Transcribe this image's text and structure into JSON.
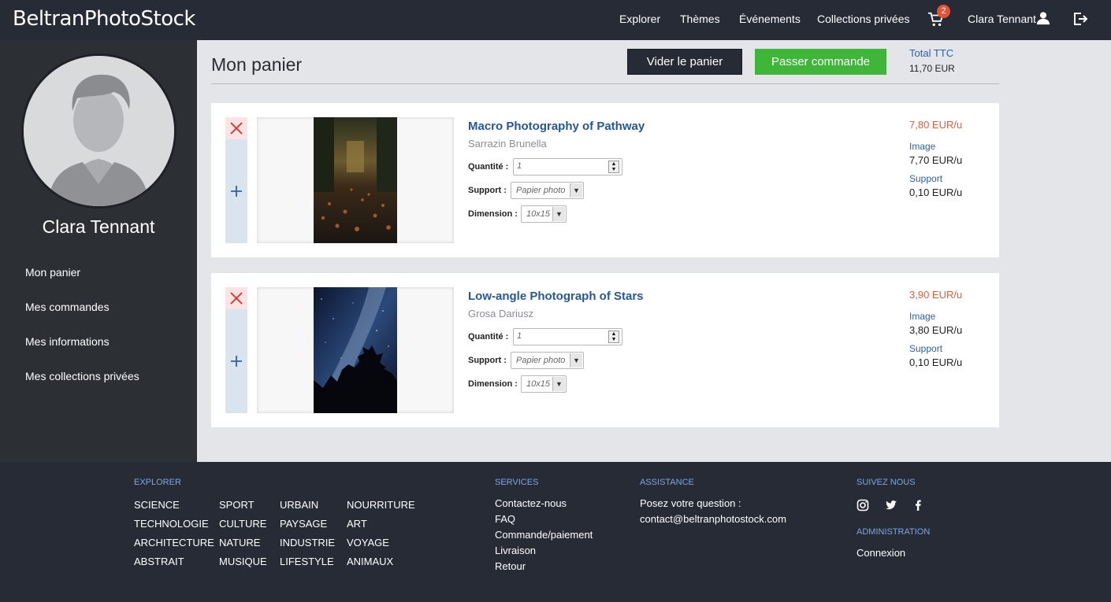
{
  "header": {
    "logo": "BeltranPhotoStock",
    "nav": [
      "Explorer",
      "Thèmes",
      "Événements",
      "Collections privées"
    ],
    "cart_count": "2",
    "user_name": "Clara Tennant"
  },
  "sidebar": {
    "name": "Clara Tennant",
    "links": [
      "Mon panier",
      "Mes commandes",
      "Mes informations",
      "Mes collections privées"
    ]
  },
  "main": {
    "title": "Mon panier",
    "clear_label": "Vider le panier",
    "checkout_label": "Passer commande",
    "total_label": "Total TTC",
    "total_value": "11,70 EUR",
    "labels": {
      "quantity": "Quantité :",
      "support": "Support :",
      "dimension": "Dimension :",
      "image": "Image",
      "support_price": "Support"
    },
    "items": [
      {
        "title": "Macro Photography of Pathway",
        "author": "Sarrazin Brunella",
        "quantity": "1",
        "support": "Papier photo",
        "dimension": "10x15",
        "price": "7,80 EUR/u",
        "image_price": "7,70 EUR/u",
        "support_price": "0,10 EUR/u"
      },
      {
        "title": "Low-angle Photograph of Stars",
        "author": "Grosa Dariusz",
        "quantity": "1",
        "support": "Papier photo",
        "dimension": "10x15",
        "price": "3,90 EUR/u",
        "image_price": "3,80 EUR/u",
        "support_price": "0,10 EUR/u"
      }
    ]
  },
  "footer": {
    "explorer_heading": "EXPLORER",
    "explorer_cols": [
      [
        "SCIENCE",
        "TECHNOLOGIE",
        "ARCHITECTURE",
        "ABSTRAIT"
      ],
      [
        "SPORT",
        "CULTURE",
        "NATURE",
        "MUSIQUE"
      ],
      [
        "URBAIN",
        "PAYSAGE",
        "INDUSTRIE",
        "LIFESTYLE"
      ],
      [
        "NOURRITURE",
        "ART",
        "VOYAGE",
        "ANIMAUX"
      ]
    ],
    "services_heading": "SERVICES",
    "services": [
      "Contactez-nous",
      "FAQ",
      "Commande/paiement",
      "Livraison",
      "Retour"
    ],
    "assistance_heading": "ASSISTANCE",
    "assistance_text": "Posez votre question :",
    "assistance_email": "contact@beltranphotostock.com",
    "follow_heading": "SUIVEZ NOUS",
    "social_icons": [
      "instagram-icon",
      "twitter-icon",
      "facebook-icon"
    ],
    "admin_heading": "ADMINISTRATION",
    "admin_link": "Connexion"
  },
  "colors": {
    "topbar": "#272b35",
    "sidebar": "#2c3035",
    "accent_blue": "#24579c",
    "price_orange": "#e2603d",
    "checkout_green": "#3fb53a",
    "badge_red": "#e2533a"
  }
}
